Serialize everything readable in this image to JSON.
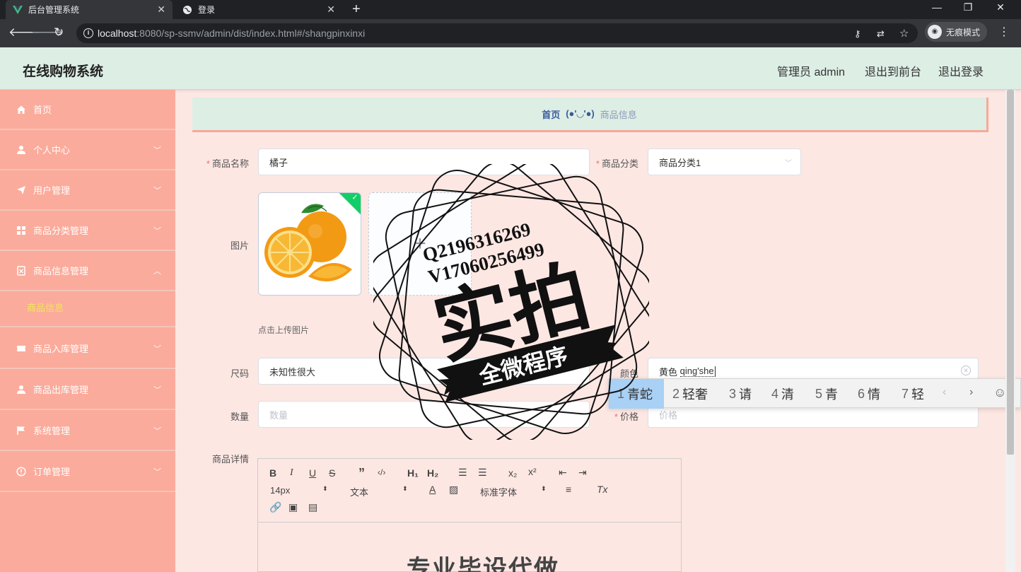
{
  "browser": {
    "tabs": [
      {
        "title": "后台管理系统",
        "active": true
      },
      {
        "title": "登录",
        "active": false
      }
    ],
    "url_host": "localhost",
    "url_rest": ":8080/sp-ssmv/admin/dist/index.html#/shangpinxinxi",
    "incognito_label": "无痕模式"
  },
  "app": {
    "title": "在线购物系统",
    "header_links": [
      "管理员 admin",
      "退出到前台",
      "退出登录"
    ]
  },
  "sidebar": {
    "items": [
      {
        "label": "首页",
        "icon": "home-icon",
        "expandable": false
      },
      {
        "label": "个人中心",
        "icon": "user-icon",
        "expandable": true
      },
      {
        "label": "用户管理",
        "icon": "send-icon",
        "expandable": true
      },
      {
        "label": "商品分类管理",
        "icon": "grid-icon",
        "expandable": true
      },
      {
        "label": "商品信息管理",
        "icon": "document-icon",
        "expandable": true,
        "expanded": true
      },
      {
        "label": "商品入库管理",
        "icon": "ticket-icon",
        "expandable": true
      },
      {
        "label": "商品出库管理",
        "icon": "user-icon",
        "expandable": true
      },
      {
        "label": "系统管理",
        "icon": "flag-icon",
        "expandable": true
      },
      {
        "label": "订单管理",
        "icon": "order-icon",
        "expandable": true
      }
    ],
    "active_subitem": "商品信息"
  },
  "breadcrumb": {
    "home": "首页",
    "separator": "(●'◡'●)",
    "current": "商品信息"
  },
  "form": {
    "name": {
      "label": "商品名称",
      "value": "橘子",
      "required": true
    },
    "category": {
      "label": "商品分类",
      "value": "商品分类1",
      "required": true
    },
    "image": {
      "label": "图片",
      "hint": "点击上传图片"
    },
    "size": {
      "label": "尺码",
      "value": "未知性很大"
    },
    "color": {
      "label": "颜色",
      "value": "黄色 ",
      "composing": "qing'she"
    },
    "quantity": {
      "label": "数量",
      "placeholder": "数量"
    },
    "price": {
      "label": "价格",
      "placeholder": "价格",
      "required": true
    },
    "detail": {
      "label": "商品详情"
    }
  },
  "ime": {
    "candidates": [
      {
        "n": "1",
        "text": "青蛇"
      },
      {
        "n": "2",
        "text": "轻奢"
      },
      {
        "n": "3",
        "text": "请"
      },
      {
        "n": "4",
        "text": "清"
      },
      {
        "n": "5",
        "text": "青"
      },
      {
        "n": "6",
        "text": "情"
      },
      {
        "n": "7",
        "text": "轻"
      }
    ]
  },
  "editor": {
    "font_size": "14px",
    "block_type": "文本",
    "font_family": "标准字体",
    "content_heading": "专业毕设代做"
  },
  "watermark": {
    "line1": "Q2196316269",
    "line2": "V17060256499",
    "big": "实拍",
    "banner": "全微程序"
  }
}
